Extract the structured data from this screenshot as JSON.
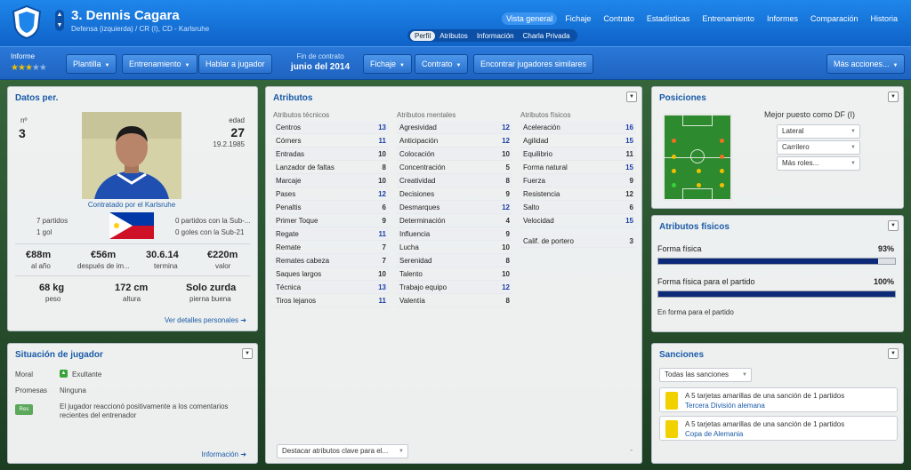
{
  "header": {
    "player_name": "3. Dennis Cagara",
    "player_sub": "Defensa (izquierda) / CR (I), CD - Karlsruhe",
    "nav": [
      "Vista general",
      "Fichaje",
      "Contrato",
      "Estadísticas",
      "Entrenamiento",
      "Informes",
      "Comparación",
      "Historia"
    ],
    "subtabs": [
      "Perfil",
      "Atributos",
      "Información",
      "Charla Privada"
    ]
  },
  "toolbar": {
    "informe": "Informe",
    "stars": 2.5,
    "plantilla": "Plantilla",
    "entrenamiento": "Entrenamiento",
    "hablar": "Hablar a jugador",
    "contract_label": "Fin de contrato",
    "contract_date": "junio del 2014",
    "fichaje": "Fichaje",
    "contrato": "Contrato",
    "encontrar": "Encontrar jugadores similares",
    "mas": "Más acciones..."
  },
  "datos": {
    "title": "Datos per.",
    "num_label": "nº",
    "num": "3",
    "age_label": "edad",
    "age": "27",
    "dob": "19.2.1985",
    "signed": "Contratado por el Karlsruhe",
    "partidos": "7 partidos",
    "goles": "1 gol",
    "sub_partidos": "0 partidos con la Sub-...",
    "sub_goles": "0 goles con la Sub-21",
    "stats": [
      {
        "v": "€88m",
        "l": "al año"
      },
      {
        "v": "€56m",
        "l": "después de im..."
      },
      {
        "v": "30.6.14",
        "l": "termina"
      },
      {
        "v": "€220m",
        "l": "valor"
      }
    ],
    "stats2": [
      {
        "v": "68 kg",
        "l": "peso"
      },
      {
        "v": "172 cm",
        "l": "altura"
      },
      {
        "v": "Solo zurda",
        "l": "pierna buena"
      }
    ],
    "link": "Ver detalles personales"
  },
  "situacion": {
    "title": "Situación de jugador",
    "moral_label": "Moral",
    "moral": "Exultante",
    "promesas_label": "Promesas",
    "promesas": "Ninguna",
    "badge": "Res",
    "note": "El jugador reaccionó positivamente a los comentarios recientes del entrenador",
    "link": "Información"
  },
  "atributos": {
    "title": "Atributos",
    "tecnicos_h": "Atributos técnicos",
    "mentales_h": "Atributos mentales",
    "fisicos_h": "Atributos físicos",
    "tecnicos": [
      [
        "Centros",
        "13"
      ],
      [
        "Córners",
        "11"
      ],
      [
        "Entradas",
        "10"
      ],
      [
        "Lanzador de faltas",
        "8"
      ],
      [
        "Marcaje",
        "10"
      ],
      [
        "Pases",
        "12"
      ],
      [
        "Penaltis",
        "6"
      ],
      [
        "Primer Toque",
        "9"
      ],
      [
        "Regate",
        "11"
      ],
      [
        "Remate",
        "7"
      ],
      [
        "Remates cabeza",
        "7"
      ],
      [
        "Saques largos",
        "10"
      ],
      [
        "Técnica",
        "13"
      ],
      [
        "Tiros lejanos",
        "11"
      ]
    ],
    "mentales": [
      [
        "Agresividad",
        "12"
      ],
      [
        "Anticipación",
        "12"
      ],
      [
        "Colocación",
        "10"
      ],
      [
        "Concentración",
        "5"
      ],
      [
        "Creatividad",
        "8"
      ],
      [
        "Decisiones",
        "9"
      ],
      [
        "Desmarques",
        "12"
      ],
      [
        "Determinación",
        "4"
      ],
      [
        "Influencia",
        "9"
      ],
      [
        "Lucha",
        "10"
      ],
      [
        "Serenidad",
        "8"
      ],
      [
        "Talento",
        "10"
      ],
      [
        "Trabajo equipo",
        "12"
      ],
      [
        "Valentía",
        "8"
      ]
    ],
    "fisicos": [
      [
        "Aceleración",
        "16"
      ],
      [
        "Agilidad",
        "15"
      ],
      [
        "Equilibrio",
        "11"
      ],
      [
        "Forma natural",
        "15"
      ],
      [
        "Fuerza",
        "9"
      ],
      [
        "Resistencia",
        "12"
      ],
      [
        "Salto",
        "6"
      ],
      [
        "Velocidad",
        "15"
      ]
    ],
    "portero": [
      "Calif. de portero",
      "3"
    ],
    "destacar": "Destacar atributos clave para el..."
  },
  "posiciones": {
    "title": "Posiciones",
    "mejor": "Mejor puesto como DF (I)",
    "options": [
      "Lateral",
      "Carrilero",
      "Más roles..."
    ]
  },
  "fisicos": {
    "title": "Atributos físicos",
    "forma_label": "Forma física",
    "forma_value": "93%",
    "forma_pct": 93,
    "partido_label": "Forma física para el partido",
    "partido_value": "100%",
    "partido_pct": 100,
    "estado": "En forma para el partido"
  },
  "sanciones": {
    "title": "Sanciones",
    "filter": "Todas las sanciones",
    "items": [
      {
        "t": "A 5 tarjetas amarillas de una sanción de 1 partidos",
        "c": "Tercera División alemana"
      },
      {
        "t": "A 5 tarjetas amarillas de una sanción de 1 partidos",
        "c": "Copa de Alemania"
      }
    ]
  },
  "colors": {
    "accent": "#1a5aa8",
    "header": "#1470d8",
    "yellow_card": "#f1d100"
  }
}
